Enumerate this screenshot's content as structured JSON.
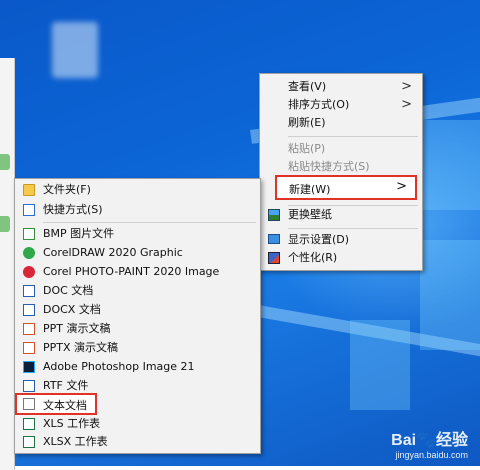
{
  "context_menu": {
    "items": [
      {
        "label": "查看(V)",
        "has_submenu": true,
        "enabled": true
      },
      {
        "label": "排序方式(O)",
        "has_submenu": true,
        "enabled": true
      },
      {
        "label": "刷新(E)",
        "has_submenu": false,
        "enabled": true
      },
      {
        "label": "粘贴(P)",
        "has_submenu": false,
        "enabled": false
      },
      {
        "label": "粘贴快捷方式(S)",
        "has_submenu": false,
        "enabled": false
      },
      {
        "label": "新建(W)",
        "has_submenu": true,
        "enabled": true,
        "highlighted": true
      },
      {
        "label": "更换壁纸",
        "has_submenu": false,
        "enabled": true,
        "icon": "wallpaper-icon"
      },
      {
        "label": "显示设置(D)",
        "has_submenu": false,
        "enabled": true,
        "icon": "display-icon"
      },
      {
        "label": "个性化(R)",
        "has_submenu": false,
        "enabled": true,
        "icon": "personalize-icon"
      }
    ],
    "arrow_glyph": ">"
  },
  "new_submenu": {
    "items": [
      {
        "label": "文件夹(F)",
        "icon": "folder-icon"
      },
      {
        "label": "快捷方式(S)",
        "icon": "shortcut-icon"
      },
      {
        "label": "BMP 图片文件",
        "icon": "bmp-file-icon"
      },
      {
        "label": "CorelDRAW 2020 Graphic",
        "icon": "coreldraw-icon"
      },
      {
        "label": "Corel PHOTO-PAINT 2020 Image",
        "icon": "corel-photopaint-icon"
      },
      {
        "label": "DOC 文档",
        "icon": "doc-file-icon"
      },
      {
        "label": "DOCX 文档",
        "icon": "docx-file-icon"
      },
      {
        "label": "PPT 演示文稿",
        "icon": "ppt-file-icon"
      },
      {
        "label": "PPTX 演示文稿",
        "icon": "pptx-file-icon"
      },
      {
        "label": "Adobe Photoshop Image 21",
        "icon": "photoshop-icon"
      },
      {
        "label": "RTF 文件",
        "icon": "rtf-file-icon"
      },
      {
        "label": "文本文档",
        "icon": "text-file-icon",
        "highlighted": true
      },
      {
        "label": "XLS 工作表",
        "icon": "xls-file-icon"
      },
      {
        "label": "XLSX 工作表",
        "icon": "xlsx-file-icon"
      }
    ]
  },
  "watermark": {
    "brand": "Bai🐾经验",
    "url": "jingyan.baidu.com"
  },
  "colors": {
    "highlight_border": "#e03325",
    "desktop_blue": "#0c66d6"
  }
}
